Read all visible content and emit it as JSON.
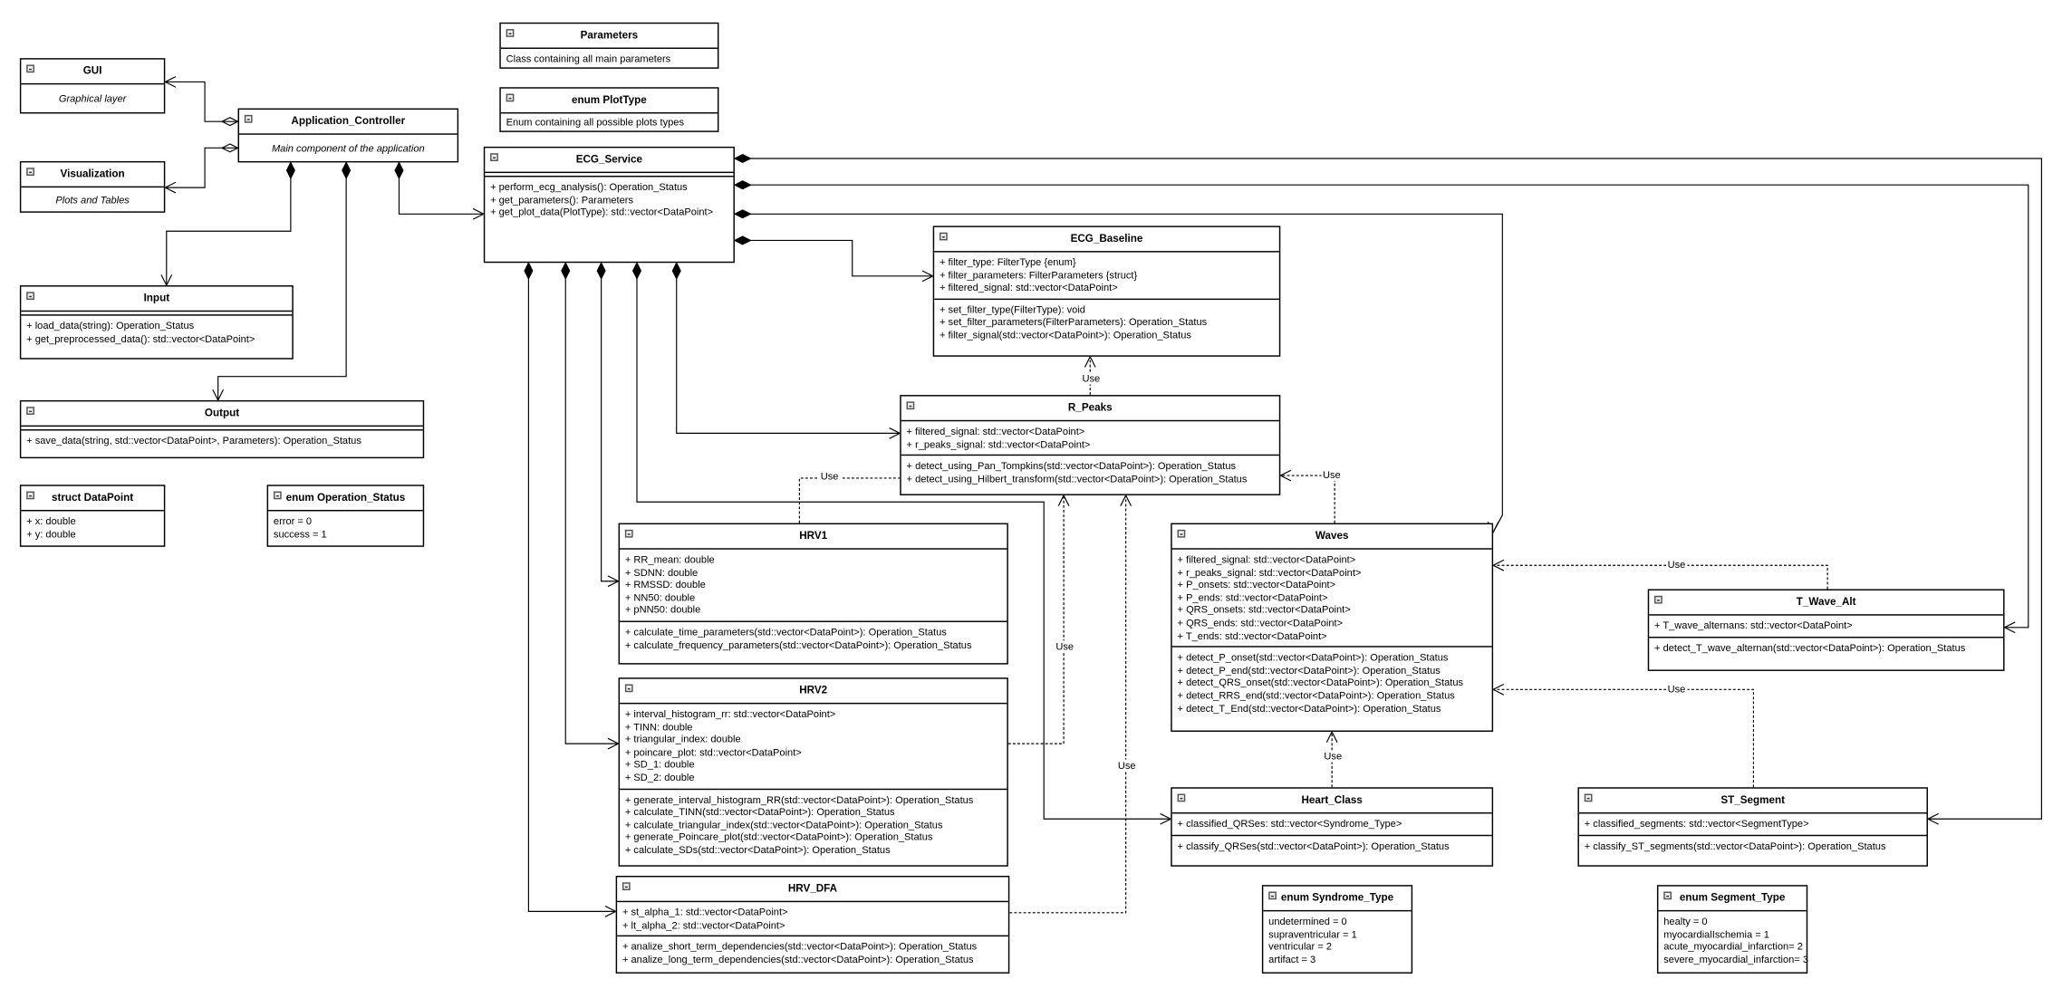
{
  "classes": [
    {
      "id": "parameters",
      "title": "Parameters",
      "description": "Class containing all main parameters",
      "italic": false
    },
    {
      "id": "plottype",
      "title": "enum PlotType",
      "description": "Enum containing all possible plots types",
      "italic": false
    },
    {
      "id": "gui",
      "title": "GUI",
      "description": "Graphical layer",
      "italic": true
    },
    {
      "id": "visualization",
      "title": "Visualization",
      "description": "Plots and Tables",
      "italic": true
    },
    {
      "id": "appctrl",
      "title": "Application_Controller",
      "description": "Main component of the application",
      "italic": true
    },
    {
      "id": "ecgservice",
      "title": "ECG_Service",
      "attributes": [],
      "methods": [
        "+ perform_ecg_analysis(): Operation_Status",
        "+ get_parameters(): Parameters",
        "+ get_plot_data(PlotType): std::vector<DataPoint>"
      ]
    },
    {
      "id": "input",
      "title": "Input",
      "attributes": [],
      "methods": [
        "+ load_data(string): Operation_Status",
        "+ get_preprocessed_data(): std::vector<DataPoint>"
      ]
    },
    {
      "id": "output",
      "title": "Output",
      "attributes": [],
      "methods": [
        "+ save_data(string, std::vector<DataPoint>, Parameters): Operation_Status"
      ]
    },
    {
      "id": "datapoint",
      "title": "struct DataPoint",
      "attributes": [
        "+ x: double",
        "+ y: double"
      ]
    },
    {
      "id": "opstatus",
      "title": "enum Operation_Status",
      "attributes": [
        "error = 0",
        "success = 1"
      ]
    },
    {
      "id": "baseline",
      "title": "ECG_Baseline",
      "attributes": [
        "+ filter_type: FilterType {enum}",
        "+ filter_parameters: FilterParameters {struct}",
        "+ filtered_signal: std::vector<DataPoint>"
      ],
      "methods": [
        "+ set_filter_type(FilterType): void",
        "+ set_filter_parameters(FilterParameters): Operation_Status",
        "+ filter_signal(std::vector<DataPoint>): Operation_Status"
      ]
    },
    {
      "id": "rpeaks",
      "title": "R_Peaks",
      "attributes": [
        "+ filtered_signal: std::vector<DataPoint>",
        "+ r_peaks_signal: std::vector<DataPoint>"
      ],
      "methods": [
        "+ detect_using_Pan_Tompkins(std::vector<DataPoint>): Operation_Status",
        "+ detect_using_Hilbert_transform(std::vector<DataPoint>): Operation_Status"
      ]
    },
    {
      "id": "hrv1",
      "title": "HRV1",
      "attributes": [
        "+ RR_mean: double",
        "+ SDNN: double",
        "+ RMSSD: double",
        "+ NN50: double",
        "+ pNN50: double"
      ],
      "methods": [
        "+ calculate_time_parameters(std::vector<DataPoint>): Operation_Status",
        "+ calculate_frequency_parameters(std::vector<DataPoint>): Operation_Status"
      ]
    },
    {
      "id": "hrv2",
      "title": "HRV2",
      "attributes": [
        "+ interval_histogram_rr: std::vector<DataPoint>",
        "+ TINN: double",
        "+ triangular_index: double",
        "+ poincare_plot: std::vector<DataPoint>",
        "+ SD_1: double",
        "+ SD_2: double"
      ],
      "methods": [
        "+ generate_interval_histogram_RR(std::vector<DataPoint>): Operation_Status",
        "+ calculate_TINN(std::vector<DataPoint>): Operation_Status",
        "+ calculate_triangular_index(std::vector<DataPoint>): Operation_Status",
        "+ generate_Poincare_plot(std::vector<DataPoint>): Operation_Status",
        "+ calculate_SDs(std::vector<DataPoint>): Operation_Status"
      ]
    },
    {
      "id": "hrvdfa",
      "title": "HRV_DFA",
      "attributes": [
        "+ st_alpha_1: std::vector<DataPoint>",
        "+ lt_alpha_2: std::vector<DataPoint>"
      ],
      "methods": [
        "+ analize_short_term_dependencies(std::vector<DataPoint>): Operation_Status",
        "+ analize_long_term_dependencies(std::vector<DataPoint>): Operation_Status"
      ]
    },
    {
      "id": "waves",
      "title": "Waves",
      "attributes": [
        "+ filtered_signal: std::vector<DataPoint>",
        "+ r_peaks_signal: std::vector<DataPoint>",
        "+ P_onsets: std::vector<DataPoint>",
        "+ P_ends: std::vector<DataPoint>",
        "+ QRS_onsets: std::vector<DataPoint>",
        "+ QRS_ends: std::vector<DataPoint>",
        "+ T_ends: std::vector<DataPoint>"
      ],
      "methods": [
        "+ detect_P_onset(std::vector<DataPoint>): Operation_Status",
        "+ detect_P_end(std::vector<DataPoint>): Operation_Status",
        "+ detect_QRS_onset(std::vector<DataPoint>): Operation_Status",
        "+ detect_RRS_end(std::vector<DataPoint>): Operation_Status",
        "+ detect_T_End(std::vector<DataPoint>): Operation_Status"
      ]
    },
    {
      "id": "twave",
      "title": "T_Wave_Alt",
      "attributes": [
        "+ T_wave_alternans: std::vector<DataPoint>"
      ],
      "methods": [
        "+ detect_T_wave_alternan(std::vector<DataPoint>): Operation_Status"
      ]
    },
    {
      "id": "heartclass",
      "title": "Heart_Class",
      "attributes": [
        "+ classified_QRSes: std::vector<Syndrome_Type>"
      ],
      "methods": [
        "+ classify_QRSes(std::vector<DataPoint>): Operation_Status"
      ]
    },
    {
      "id": "stsegment",
      "title": "ST_Segment",
      "attributes": [
        "+ classified_segments: std::vector<SegmentType>"
      ],
      "methods": [
        "+ classify_ST_segments(std::vector<DataPoint>): Operation_Status"
      ]
    },
    {
      "id": "syndrome",
      "title": "enum Syndrome_Type",
      "attributes": [
        "undetermined = 0",
        "supraventricular = 1",
        "ventricular = 2",
        "artifact = 3"
      ]
    },
    {
      "id": "segtype",
      "title": "enum Segment_Type",
      "attributes": [
        "healty = 0",
        "myocardialIschemia = 1",
        "acute_myocardial_infarction= 2",
        "severe_myocardial_infarction= 3"
      ]
    }
  ],
  "dependency_label": "Use",
  "colors": {
    "line": "#000000",
    "background": "#ffffff"
  }
}
